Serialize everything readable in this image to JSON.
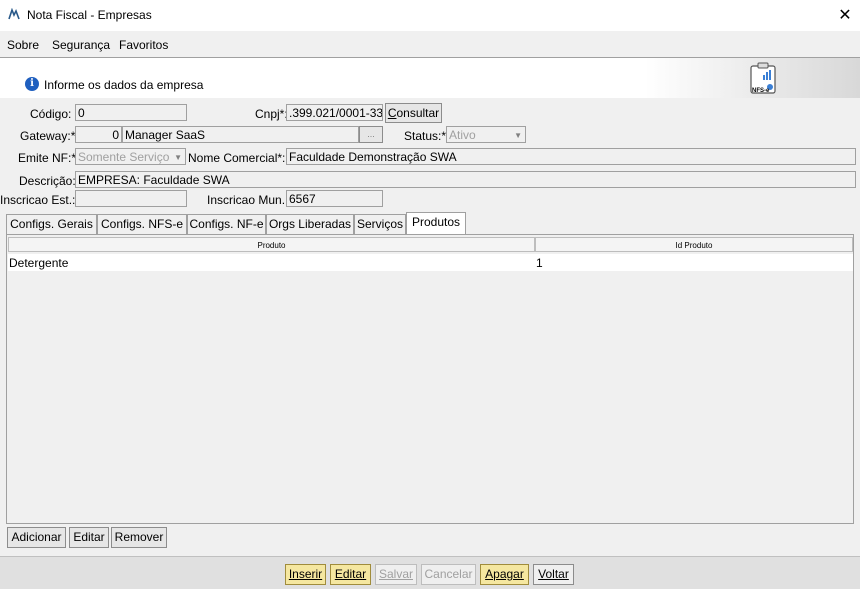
{
  "window": {
    "title": "Nota Fiscal - Empresas",
    "close": "✕"
  },
  "menu": {
    "items": [
      "Sobre",
      "Segurança",
      "Favoritos"
    ]
  },
  "banner": {
    "info_glyph": "i",
    "text": "Informe os dados da empresa",
    "logo_text": "NFS-e"
  },
  "form": {
    "codigo": {
      "label": "Código:",
      "value": "0"
    },
    "cnpj": {
      "label": "Cnpj*:",
      "value": ".399.021/0001-33",
      "button": "Consultar"
    },
    "gateway": {
      "label": "Gateway:*",
      "id": "0",
      "name": "Manager SaaS",
      "lookup": "..."
    },
    "status": {
      "label": "Status:*",
      "value": "Ativo"
    },
    "emite_nf": {
      "label": "Emite NF:*",
      "value": "Somente Serviço"
    },
    "nome_comercial": {
      "label": "Nome Comercial*:",
      "value": "Faculdade Demonstração SWA"
    },
    "descricao": {
      "label": "Descrição:",
      "value": "EMPRESA: Faculdade SWA"
    },
    "inscricao_est": {
      "label": "Inscricao Est.:",
      "value": ""
    },
    "inscricao_mun": {
      "label": "Inscricao Mun.:",
      "value": "6567"
    }
  },
  "tabs": [
    "Configs. Gerais",
    "Configs. NFS-e",
    "Configs. NF-e",
    "Orgs Liberadas",
    "Serviços",
    "Produtos"
  ],
  "active_tab": "Produtos",
  "grid": {
    "columns": [
      "Produto",
      "Id Produto"
    ],
    "rows": [
      {
        "produto": "Detergente",
        "id": "1"
      }
    ]
  },
  "grid_actions": [
    "Adicionar",
    "Editar",
    "Remover"
  ],
  "bottom_actions": [
    {
      "label": "Inserir",
      "state": "enabled-highlight"
    },
    {
      "label": "Editar",
      "state": "enabled-highlight"
    },
    {
      "label": "Salvar",
      "state": "disabled"
    },
    {
      "label": "Cancelar",
      "state": "disabled"
    },
    {
      "label": "Apagar",
      "state": "enabled-highlight"
    },
    {
      "label": "Voltar",
      "state": "enabled"
    }
  ],
  "colors": {
    "highlight_button": "#f5e7a0",
    "info_icon": "#1f5fbf"
  }
}
